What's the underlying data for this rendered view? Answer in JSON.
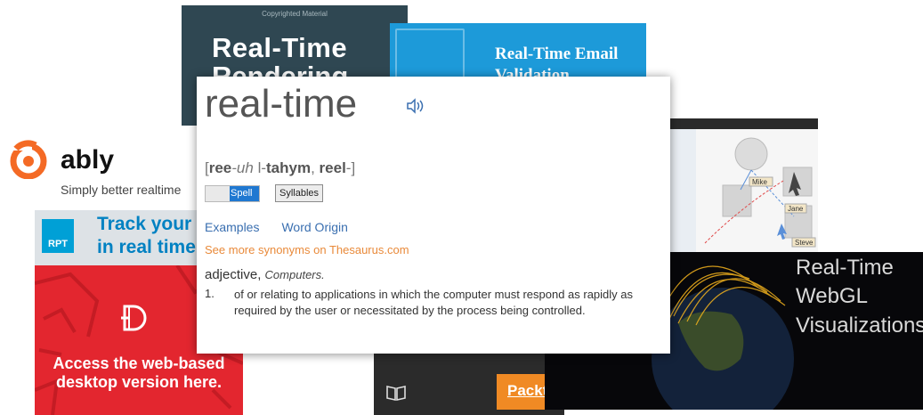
{
  "book": {
    "copyright": "Copyrighted Material",
    "title_line1": "Real-Time",
    "title_line2": "Rendering"
  },
  "email_banner": {
    "line1": "Real-Time Email",
    "line2": "Validation"
  },
  "ably": {
    "name": "ably",
    "tagline": "Simply better realtime"
  },
  "rpt_banner": {
    "badge": "RPT",
    "line1": "Track your b",
    "line2": "in real time."
  },
  "red_ad": {
    "line1": "Access the web-based",
    "line2": "desktop version here."
  },
  "diagram": {
    "labels": [
      "Mike",
      "Jane",
      "Steve"
    ]
  },
  "packt": {
    "badge": "Packt"
  },
  "webgl": {
    "line1": "Real-Time",
    "line2": "WebGL",
    "line3": "Visualizations"
  },
  "dictionary": {
    "word": "real-time",
    "audio_icon": "speaker-icon",
    "pron_open": "[",
    "pron_ree": "ree",
    "pron_uh": "-uh",
    "pron_mid": " l-",
    "pron_tahym": "tahym",
    "pron_sep": ", ",
    "pron_reel": "reel",
    "pron_close": "-]",
    "toggle_label": "Spell",
    "syllables_button": "Syllables",
    "tab_examples": "Examples",
    "tab_origin": "Word Origin",
    "synonyms_link": "See more synonyms on Thesaurus.com",
    "part_of_speech": "adjective,",
    "field": "Computers.",
    "def_number": "1.",
    "definition": "of or relating to applications in which the computer must respond as rapidly as required by the user or necessitated by the process being controlled."
  },
  "colors": {
    "link_blue": "#3a6fb0",
    "synonym_orange": "#e98a3a",
    "toggle_blue": "#1f78d1"
  }
}
